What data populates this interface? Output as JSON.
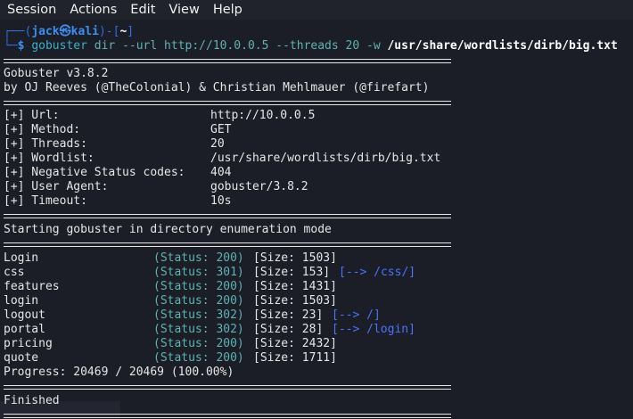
{
  "menu": [
    "Session",
    "Actions",
    "Edit",
    "View",
    "Help"
  ],
  "prompt": {
    "line1_prefix": "┌──(",
    "user": "jack",
    "at": "㉿",
    "host": "kali",
    "mid": ")-[",
    "dir": "~",
    "close": "]",
    "line2_prefix": "└─",
    "dollar": "$",
    "cmd": "gobuster",
    "args": " dir --url http://10.0.0.5 --threads 20 -w ",
    "wordlist": "/usr/share/wordlists/dirb/big.txt"
  },
  "banner": {
    "version": "Gobuster v3.8.2",
    "authors": "by OJ Reeves (@TheColonial) & Christian Mehlmauer (@firefart)"
  },
  "config": [
    {
      "key": "[+] Url:",
      "value": "http://10.0.0.5"
    },
    {
      "key": "[+] Method:",
      "value": "GET"
    },
    {
      "key": "[+] Threads:",
      "value": "20"
    },
    {
      "key": "[+] Wordlist:",
      "value": "/usr/share/wordlists/dirb/big.txt"
    },
    {
      "key": "[+] Negative Status codes:",
      "value": "404"
    },
    {
      "key": "[+] User Agent:",
      "value": "gobuster/3.8.2"
    },
    {
      "key": "[+] Timeout:",
      "value": "10s"
    }
  ],
  "starting": "Starting gobuster in directory enumeration mode",
  "results": [
    {
      "path": "Login",
      "status": "(Status: 200)",
      "size": "[Size: 1503]",
      "redirect": ""
    },
    {
      "path": "css",
      "status": "(Status: 301)",
      "size": "[Size: 153]",
      "redirect": "[--> /css/]"
    },
    {
      "path": "features",
      "status": "(Status: 200)",
      "size": "[Size: 1431]",
      "redirect": ""
    },
    {
      "path": "login",
      "status": "(Status: 200)",
      "size": "[Size: 1503]",
      "redirect": ""
    },
    {
      "path": "logout",
      "status": "(Status: 302)",
      "size": "[Size: 23]",
      "redirect": "[--> /]"
    },
    {
      "path": "portal",
      "status": "(Status: 302)",
      "size": "[Size: 28]",
      "redirect": "[--> /login]"
    },
    {
      "path": "pricing",
      "status": "(Status: 200)",
      "size": "[Size: 2432]",
      "redirect": ""
    },
    {
      "path": "quote",
      "status": "(Status: 200)",
      "size": "[Size: 1711]",
      "redirect": ""
    }
  ],
  "progress": "Progress: 20469 / 20469 (100.00%)",
  "finished": "Finished"
}
